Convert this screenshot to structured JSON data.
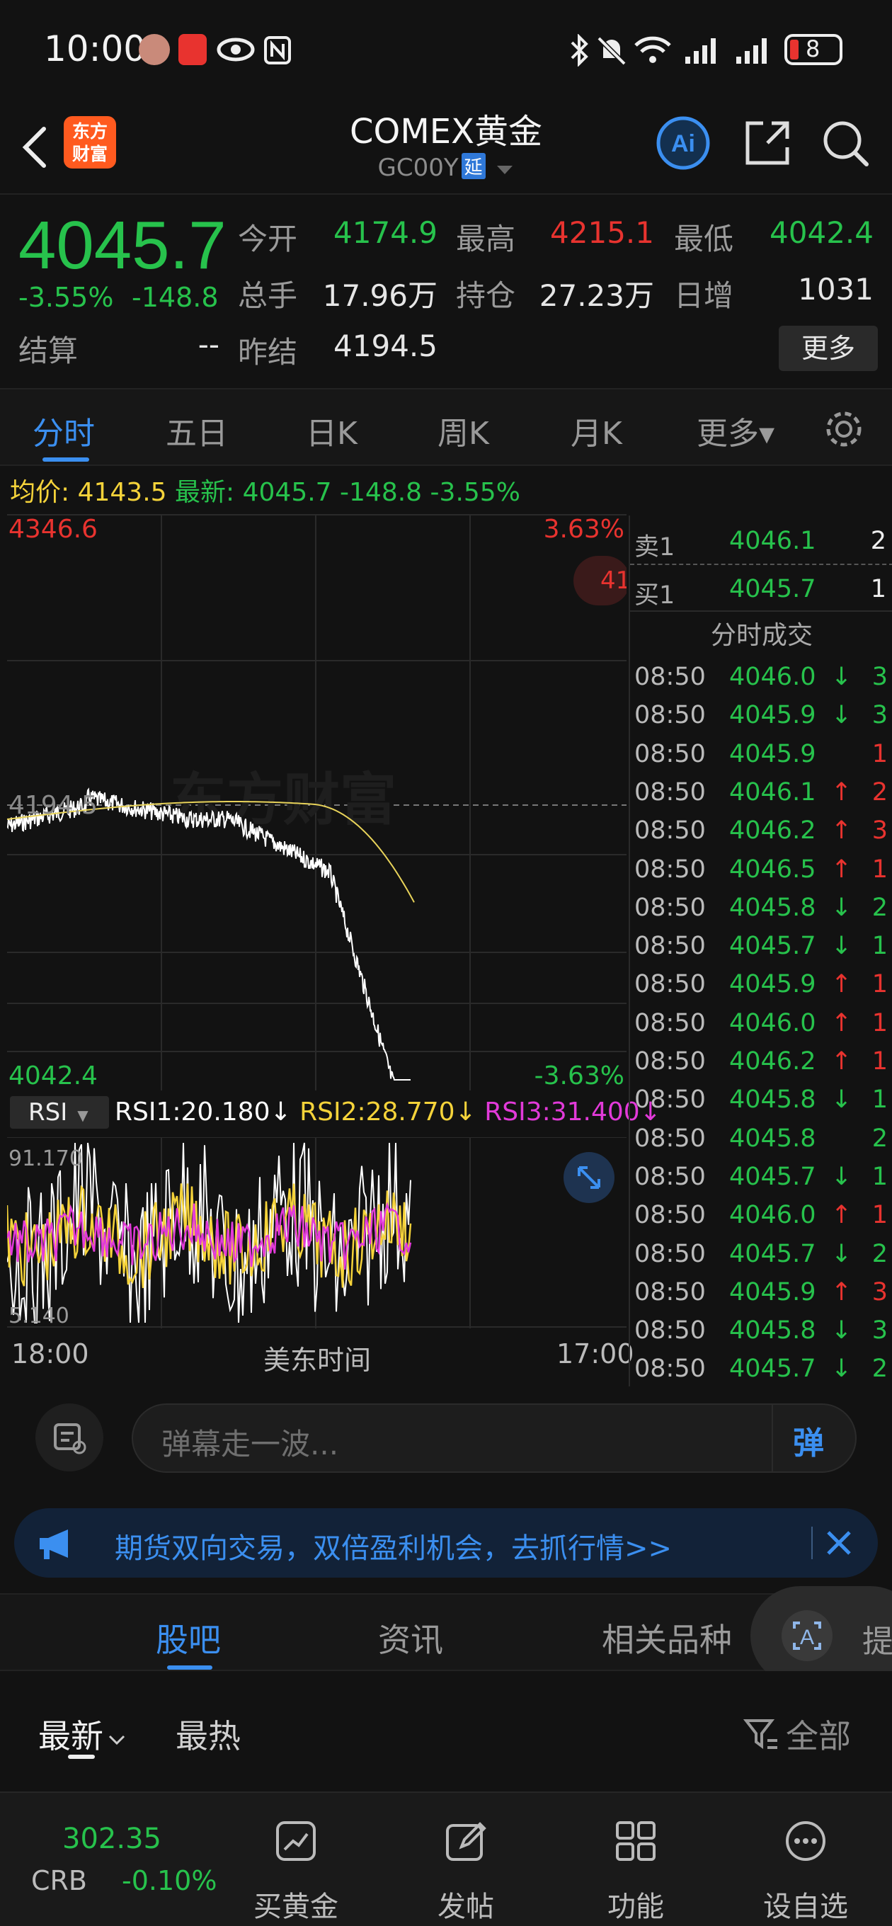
{
  "status_bar": {
    "time": "10:00",
    "battery": "8"
  },
  "header": {
    "logo_text_1": "东方",
    "logo_text_2": "财富",
    "title": "COMEX黄金",
    "code": "GC00Y",
    "delay_badge": "延"
  },
  "quote": {
    "last": "4045.7",
    "pct": "-3.55%",
    "change": "-148.8",
    "settle_label": "结算",
    "settle_value": "--",
    "fields": [
      {
        "label": "今开",
        "value": "4174.9",
        "color": "#27c24c"
      },
      {
        "label": "最高",
        "value": "4215.1",
        "color": "#e8332f"
      },
      {
        "label": "最低",
        "value": "4042.4",
        "color": "#27c24c"
      },
      {
        "label": "总手",
        "value": "17.96万",
        "color": "#e6e6e6"
      },
      {
        "label": "持仓",
        "value": "27.23万",
        "color": "#e6e6e6"
      },
      {
        "label": "日增",
        "value": "1031",
        "color": "#e6e6e6"
      },
      {
        "label": "昨结",
        "value": "4194.5",
        "color": "#e6e6e6"
      }
    ],
    "more_label": "更多"
  },
  "period_tabs": [
    "分时",
    "五日",
    "日K",
    "周K",
    "月K",
    "更多▾"
  ],
  "avg_bar": {
    "avg_label": "均价:",
    "avg_value": "4143.5",
    "latest_label": "最新:",
    "latest_value": "4045.7",
    "change": "-148.8",
    "pct": "-3.55%"
  },
  "chart": {
    "top_price": "4346.6",
    "top_pct": "3.63%",
    "mid_price": "4194.5",
    "bottom_price": "4042.4",
    "bottom_pct": "-3.63%",
    "watermark": "东方财富",
    "rsi_selector": "RSI",
    "rsi1": "RSI1:20.180↓",
    "rsi2": "RSI2:28.770↓",
    "rsi3": "RSI3:31.400↓",
    "rsi_top": "91.170",
    "rsi_bottom": "5.140",
    "time_start": "18:00",
    "time_mid": "美东时间",
    "time_end": "17:00",
    "colors": {
      "price": "#ffffff",
      "avg": "#e8d35a",
      "rsi1": "#ffffff",
      "rsi2": "#f5d33a",
      "rsi3": "#e23ad9"
    }
  },
  "orderbook": {
    "ask": {
      "label": "卖1",
      "price": "4046.1",
      "qty": "2"
    },
    "bid": {
      "label": "买1",
      "price": "4045.7",
      "qty": "1"
    },
    "trades_title": "分时成交",
    "trades": [
      {
        "time": "08:50",
        "price": "4046.0",
        "dir": "↓",
        "qty": "3"
      },
      {
        "time": "08:50",
        "price": "4045.9",
        "dir": "↓",
        "qty": "3"
      },
      {
        "time": "08:50",
        "price": "4045.9",
        "dir": "",
        "qty": "1"
      },
      {
        "time": "08:50",
        "price": "4046.1",
        "dir": "↑",
        "qty": "2"
      },
      {
        "time": "08:50",
        "price": "4046.2",
        "dir": "↑",
        "qty": "3"
      },
      {
        "time": "08:50",
        "price": "4046.5",
        "dir": "↑",
        "qty": "1"
      },
      {
        "time": "08:50",
        "price": "4045.8",
        "dir": "↓",
        "qty": "2"
      },
      {
        "time": "08:50",
        "price": "4045.7",
        "dir": "↓",
        "qty": "1"
      },
      {
        "time": "08:50",
        "price": "4045.9",
        "dir": "↑",
        "qty": "1"
      },
      {
        "time": "08:50",
        "price": "4046.0",
        "dir": "↑",
        "qty": "1"
      },
      {
        "time": "08:50",
        "price": "4046.2",
        "dir": "↑",
        "qty": "1"
      },
      {
        "time": "08:50",
        "price": "4045.8",
        "dir": "↓",
        "qty": "1"
      },
      {
        "time": "08:50",
        "price": "4045.8",
        "dir": "",
        "qty": "2"
      },
      {
        "time": "08:50",
        "price": "4045.7",
        "dir": "↓",
        "qty": "1"
      },
      {
        "time": "08:50",
        "price": "4046.0",
        "dir": "↑",
        "qty": "1"
      },
      {
        "time": "08:50",
        "price": "4045.7",
        "dir": "↓",
        "qty": "2"
      },
      {
        "time": "08:50",
        "price": "4045.9",
        "dir": "↑",
        "qty": "3"
      },
      {
        "time": "08:50",
        "price": "4045.8",
        "dir": "↓",
        "qty": "3"
      },
      {
        "time": "08:50",
        "price": "4045.7",
        "dir": "↓",
        "qty": "2"
      }
    ]
  },
  "danmaku": {
    "placeholder": "弹幕走一波...",
    "send_label": "弹"
  },
  "promo": {
    "text": "期货双向交易，双倍盈利机会，去抓行情>>"
  },
  "content_tabs": [
    "股吧",
    "资讯",
    "相关品种"
  ],
  "float_ai_label": "提",
  "sort_bar": {
    "newest": "最新",
    "hottest": "最热",
    "filter": "全部"
  },
  "bottom_nav": {
    "ticker_price": "302.35",
    "ticker_name": "CRB",
    "ticker_change": "-0.10%",
    "items": [
      "买黄金",
      "发帖",
      "功能",
      "设自选"
    ]
  }
}
